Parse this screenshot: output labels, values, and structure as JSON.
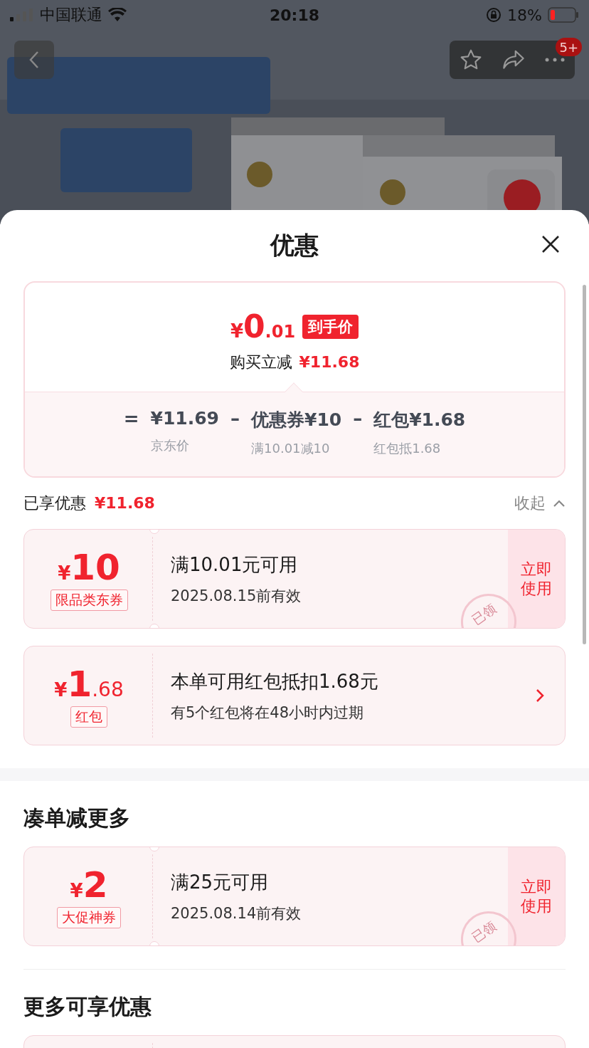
{
  "status_bar": {
    "carrier": "中国联通",
    "time": "20:18",
    "battery": "18%"
  },
  "nav": {
    "badge": "5+"
  },
  "sheet": {
    "title": "优惠"
  },
  "summary": {
    "price": {
      "currency": "¥",
      "integer": "0",
      "decimal": ".01"
    },
    "price_tag": "到手价",
    "reduction_label": "购买立减",
    "reduction_value": "¥11.68",
    "formula": [
      {
        "kind": "op",
        "text": "="
      },
      {
        "kind": "term",
        "value": "¥11.69",
        "caption": "京东价"
      },
      {
        "kind": "op",
        "text": "–"
      },
      {
        "kind": "term",
        "value": "优惠券¥10",
        "caption": "满10.01减10"
      },
      {
        "kind": "op",
        "text": "–"
      },
      {
        "kind": "term",
        "value": "红包¥1.68",
        "caption": "红包抵1.68"
      }
    ]
  },
  "enjoyed": {
    "label": "已享优惠",
    "value": "¥11.68",
    "toggle": "收起",
    "expanded": true
  },
  "applied": [
    {
      "kind": "coupon",
      "currency": "¥",
      "integer": "10",
      "tag": "限品类东券",
      "title": "满10.01元可用",
      "subtitle": "2025.08.15前有效",
      "action": "立即使用",
      "stamp": "已领"
    },
    {
      "kind": "redpacket",
      "currency": "¥",
      "integer": "1",
      "decimal": ".68",
      "tag": "红包",
      "title": "本单可用红包抵扣1.68元",
      "subtitle": "有5个红包将在48小时内过期"
    }
  ],
  "more_section": {
    "title": "凑单减更多",
    "items": [
      {
        "kind": "coupon",
        "currency": "¥",
        "integer": "2",
        "tag": "大促神券",
        "title": "满25元可用",
        "subtitle": "2025.08.14前有效",
        "action": "立即使用",
        "stamp": "已领"
      }
    ]
  },
  "extra_section": {
    "title": "更多可享优惠"
  }
}
